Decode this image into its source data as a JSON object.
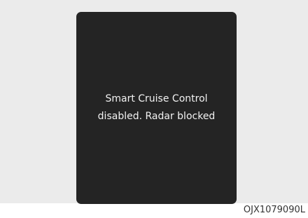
{
  "display": {
    "message_line1": "Smart Cruise Control",
    "message_line2": "disabled. Radar blocked"
  },
  "figure_code": "OJX1079090L",
  "colors": {
    "background": "#ebebeb",
    "screen": "#242424",
    "text": "#f2f2f2"
  }
}
